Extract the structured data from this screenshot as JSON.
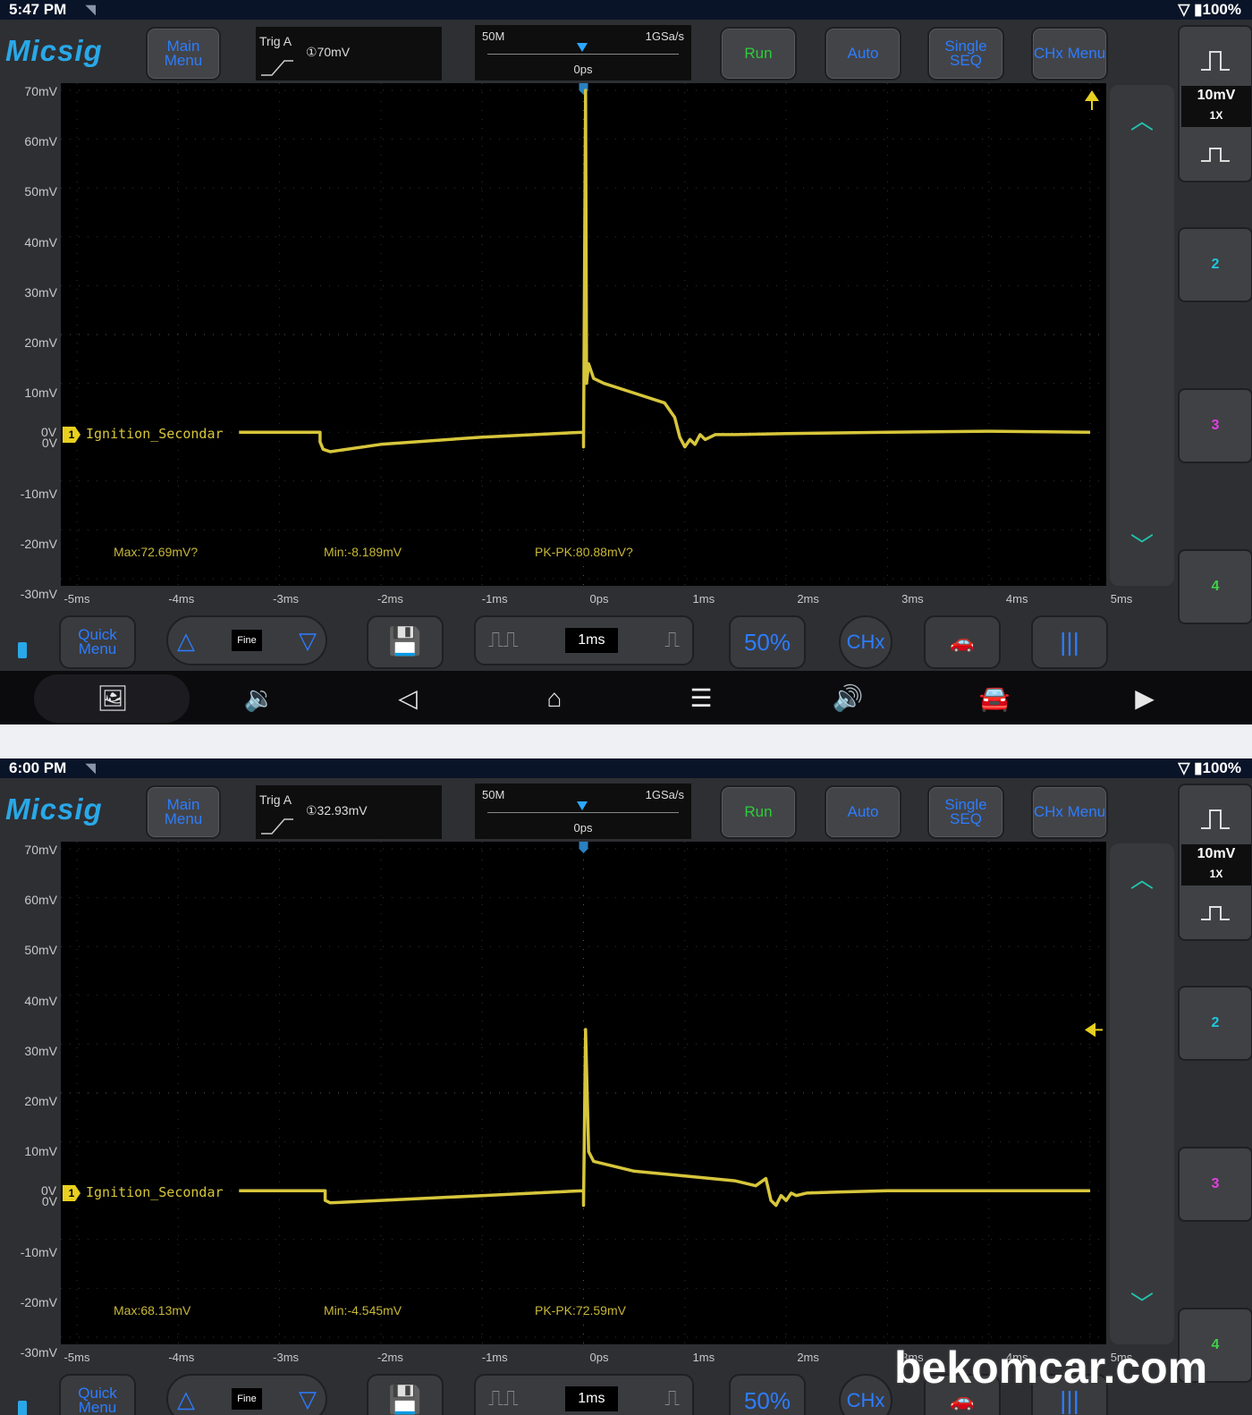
{
  "watermark": "bekomcar.com",
  "screens": [
    {
      "status": {
        "time": "5:47 PM",
        "battery": "100%"
      },
      "logo": "Micsig",
      "buttons": {
        "main_menu": "Main Menu",
        "run": "Run",
        "auto": "Auto",
        "single_seq": "Single SEQ",
        "chx_menu": "CHx Menu"
      },
      "trigger": {
        "label": "Trig A",
        "value": "①70mV"
      },
      "timebase": {
        "memory": "50M",
        "sample_rate": "1GSa/s",
        "position": "0ps"
      },
      "y_labels": [
        "70mV",
        "60mV",
        "50mV",
        "40mV",
        "30mV",
        "20mV",
        "10mV",
        "0V",
        "-10mV",
        "-20mV",
        "-30mV"
      ],
      "x_labels": [
        "-5ms",
        "-4ms",
        "-3ms",
        "-2ms",
        "-1ms",
        "0ps",
        "1ms",
        "2ms",
        "3ms",
        "4ms",
        "5ms"
      ],
      "channel": {
        "num": "1",
        "name": "Ignition_Secondar"
      },
      "measurements": {
        "max": "Max:72.69mV?",
        "min": "Min:-8.189mV",
        "pkpk": "PK-PK:80.88mV?"
      },
      "scale": {
        "volts": "10mV",
        "probe": "1X"
      },
      "channel_buttons": [
        "2",
        "3",
        "4"
      ],
      "bottom": {
        "quick_menu": "Quick Menu",
        "fine": "Fine",
        "timebase": "1ms",
        "fifty": "50%",
        "chx": "CHx"
      },
      "trig_level_mv": 70,
      "chart_data": {
        "type": "line",
        "xlim_ms": [
          -5,
          5
        ],
        "ylim_mV": [
          -30,
          70
        ],
        "x_ms": [
          -3.4,
          -2.6,
          -2.6,
          -2.57,
          -2.5,
          -2,
          -1,
          0,
          0,
          0.02,
          0.03,
          0.05,
          0.1,
          0.2,
          0.5,
          0.8,
          0.9,
          0.95,
          1.0,
          1.05,
          1.1,
          1.15,
          1.2,
          1.3,
          1.5,
          2,
          3,
          4,
          5
        ],
        "y_mV": [
          0,
          0,
          -2,
          -3.5,
          -4,
          -2.5,
          -1,
          0,
          -3,
          70,
          10,
          14,
          11,
          10,
          8,
          6,
          3,
          -1,
          -3,
          -1.5,
          -2.5,
          -0.5,
          -1.5,
          -0.5,
          -0.5,
          -0.3,
          0,
          0.2,
          0
        ]
      }
    },
    {
      "status": {
        "time": "6:00 PM",
        "battery": "100%"
      },
      "logo": "Micsig",
      "buttons": {
        "main_menu": "Main Menu",
        "run": "Run",
        "auto": "Auto",
        "single_seq": "Single SEQ",
        "chx_menu": "CHx Menu"
      },
      "trigger": {
        "label": "Trig A",
        "value": "①32.93mV"
      },
      "timebase": {
        "memory": "50M",
        "sample_rate": "1GSa/s",
        "position": "0ps"
      },
      "y_labels": [
        "70mV",
        "60mV",
        "50mV",
        "40mV",
        "30mV",
        "20mV",
        "10mV",
        "0V",
        "-10mV",
        "-20mV",
        "-30mV"
      ],
      "x_labels": [
        "-5ms",
        "-4ms",
        "-3ms",
        "-2ms",
        "-1ms",
        "0ps",
        "1ms",
        "2ms",
        "3ms",
        "4ms",
        "5ms"
      ],
      "channel": {
        "num": "1",
        "name": "Ignition_Secondar"
      },
      "measurements": {
        "max": "Max:68.13mV",
        "min": "Min:-4.545mV",
        "pkpk": "PK-PK:72.59mV"
      },
      "scale": {
        "volts": "10mV",
        "probe": "1X"
      },
      "channel_buttons": [
        "2",
        "3",
        "4"
      ],
      "bottom": {
        "quick_menu": "Quick Menu",
        "fine": "Fine",
        "timebase": "1ms",
        "fifty": "50%",
        "chx": "CHx"
      },
      "trig_level_mv": 32.93,
      "chart_data": {
        "type": "line",
        "xlim_ms": [
          -5,
          5
        ],
        "ylim_mV": [
          -30,
          70
        ],
        "x_ms": [
          -3.4,
          -2.55,
          -2.55,
          -2.5,
          -2,
          -1,
          0,
          0,
          0.02,
          0.05,
          0.1,
          0.5,
          1,
          1.5,
          1.7,
          1.8,
          1.85,
          1.9,
          1.95,
          2.0,
          2.05,
          2.1,
          2.2,
          2.5,
          3,
          4,
          5
        ],
        "y_mV": [
          0,
          0,
          -2,
          -2.5,
          -2,
          -1,
          0,
          -3,
          33,
          8,
          6,
          4,
          3,
          2,
          1,
          2.5,
          -2,
          -3,
          -1,
          -2,
          -0.5,
          -1,
          -0.5,
          -0.3,
          0,
          0,
          0
        ]
      }
    }
  ]
}
